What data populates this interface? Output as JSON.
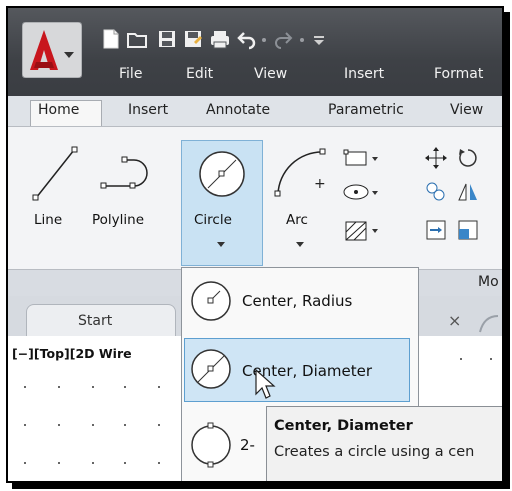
{
  "menubar": {
    "items": [
      "File",
      "Edit",
      "View",
      "Insert",
      "Format"
    ]
  },
  "ribbon": {
    "tabs": [
      "Home",
      "Insert",
      "Annotate",
      "Parametric",
      "View"
    ],
    "tools": {
      "line": "Line",
      "polyline": "Polyline",
      "circle": "Circle",
      "arc": "Arc"
    },
    "panel_footer_label": "Mo"
  },
  "file_tabs": {
    "start": "Start",
    "close_symbol": "×"
  },
  "viewport": {
    "label": "[−][Top][2D Wire"
  },
  "circle_menu": {
    "items": [
      "Center, Radius",
      "Center, Diameter",
      "2-"
    ],
    "highlighted": "Center, Diameter"
  },
  "tooltip": {
    "title": "Center, Diameter",
    "description": "Creates a circle using a cen"
  },
  "colors": {
    "accent_red": "#c8161d",
    "highlight_blue": "#cfe5f5",
    "titlebar": "#3e4146"
  }
}
